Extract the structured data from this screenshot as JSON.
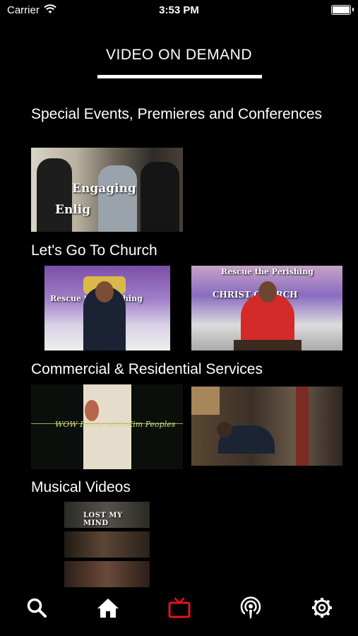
{
  "status_bar": {
    "carrier": "Carrier",
    "time": "3:53 PM"
  },
  "header": {
    "title": "VIDEO ON DEMAND"
  },
  "sections": [
    {
      "title": "Special Events, Premieres and Conferences",
      "thumbs": [
        {
          "overlay_1": "Engaging",
          "overlay_2": "Enlig"
        }
      ]
    },
    {
      "title": "Let's Go To Church",
      "thumbs": [
        {
          "caption": "Rescue the Perishing"
        },
        {
          "caption": "Rescue the Perishing",
          "caption_2": "CHRIST CHURCH"
        }
      ]
    },
    {
      "title": "Commercial & Residential Services",
      "thumbs": [
        {
          "caption": "WOW Fabric with Kim Peoples"
        },
        {}
      ]
    },
    {
      "title": "Musical Videos",
      "thumbs": [
        {
          "caption": "LOST MY MIND"
        },
        {},
        {}
      ]
    }
  ],
  "tab_bar": {
    "active_color": "#e0141e",
    "icons": [
      "search-icon",
      "home-icon",
      "tv-icon",
      "podcast-icon",
      "gear-icon"
    ]
  }
}
